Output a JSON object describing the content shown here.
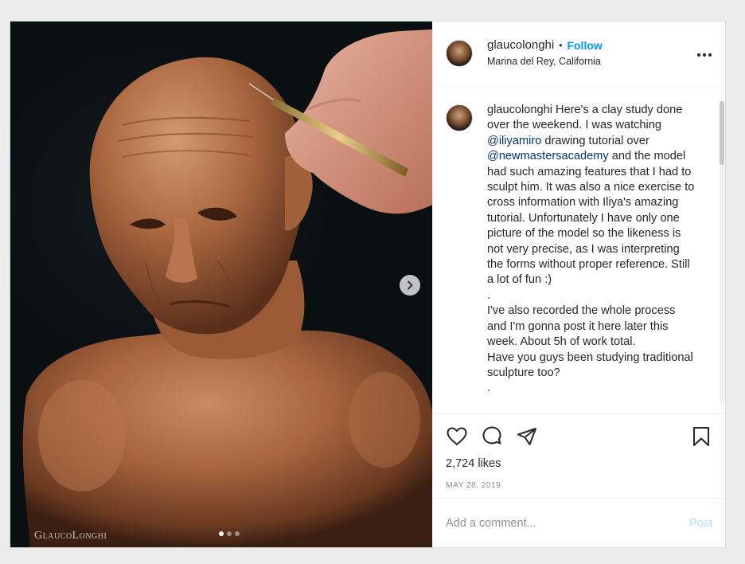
{
  "photo": {
    "watermark": "GlaucoLonghi",
    "carousel": {
      "current": 1,
      "total": 3
    }
  },
  "header": {
    "username": "glaucolonghi",
    "separator": "•",
    "follow_label": "Follow",
    "location": "Marina del Rey, California",
    "more_label": "•••"
  },
  "caption": {
    "username": "glaucolonghi",
    "text_1": " Here's a clay study done over the weekend. I was watching ",
    "mention_1": "@iliyamiro",
    "text_2": " drawing tutorial over ",
    "mention_2": "@newmastersacademy",
    "text_3": " and the model had such amazing features that I had to sculpt him. It was also a nice exercise to cross information with Iliya's amazing tutorial. Unfortunately I have only one picture of the model so the likeness is not very precise, as I was interpreting the forms without proper reference. Still a lot of fun :)",
    "line_dot_1": ".",
    "paragraph_2": "I've also recorded the whole process and I'm gonna post it here later this week. About 5h of work total.",
    "paragraph_3": "Have you guys been studying traditional sculpture too?",
    "line_dot_2": "."
  },
  "actions": {
    "icons": [
      "heart-icon",
      "comment-icon",
      "share-icon",
      "bookmark-icon"
    ],
    "likes": "2,724 likes",
    "date": "MAY 28, 2019"
  },
  "add_comment": {
    "placeholder": "Add a comment...",
    "post_label": "Post"
  },
  "colors": {
    "follow": "#0095f6",
    "mention": "#00376b",
    "post_disabled": "#b2dffc"
  }
}
